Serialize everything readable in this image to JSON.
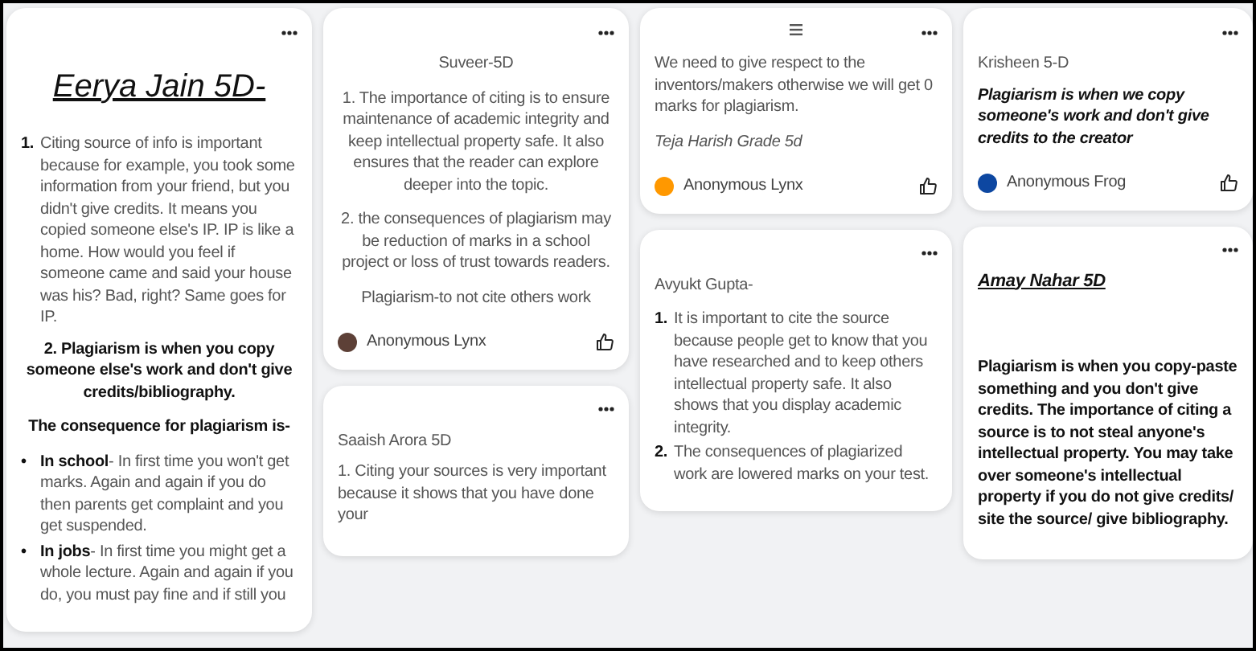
{
  "columns": [
    {
      "cards": [
        {
          "kind": "plain",
          "blocks": [
            {
              "kind": "title",
              "text": "Eerya Jain 5D-"
            },
            {
              "kind": "numbered",
              "items": [
                {
                  "marker": "1.",
                  "text": "Citing source of info is important because for example, you took some information from your friend, but you didn't give credits. It means you copied someone else's IP. IP is like a home. How would you feel if someone came and said your house was his? Bad, right? Same goes for IP."
                }
              ]
            },
            {
              "kind": "bold-center",
              "text": "2. Plagiarism is when you copy someone else's work and don't give credits/bibliography."
            },
            {
              "kind": "bold-center",
              "text": "The consequence for plagiarism is-"
            },
            {
              "kind": "bullets",
              "items": [
                {
                  "marker": "•",
                  "text": "**In school**- In first time you won't get marks. Again and again if you do then parents get complaint and you get suspended."
                },
                {
                  "marker": "•",
                  "text": "**In jobs**- In first time you might get a whole lecture. Again and again if you do, you must pay fine and if still you"
                }
              ]
            }
          ]
        }
      ]
    },
    {
      "cards": [
        {
          "kind": "plain",
          "blocks": [
            {
              "kind": "center",
              "text": "Suveer-5D"
            },
            {
              "kind": "center",
              "text": "1. The importance of citing is to ensure maintenance of academic integrity and keep intellectual property safe. It also ensures that the reader can explore deeper into the topic."
            },
            {
              "kind": "center",
              "text": "2. the consequences of plagiarism may be reduction of marks in a school project or loss of trust towards readers."
            },
            {
              "kind": "center",
              "text": "Plagiarism-to not cite others work"
            }
          ],
          "author": {
            "name": "Anonymous Lynx",
            "color": "#5d4037"
          }
        },
        {
          "kind": "plain",
          "blocks": [
            {
              "kind": "label",
              "text": "Saaish Arora 5D"
            },
            {
              "kind": "left",
              "text": "1. Citing your sources is very important because it shows that you have done your"
            }
          ]
        }
      ]
    },
    {
      "cards": [
        {
          "kind": "handle",
          "blocks": [
            {
              "kind": "left",
              "text": "We need to give respect to the inventors/makers otherwise we will get 0 marks for plagiarism."
            },
            {
              "kind": "italic",
              "text": "Teja Harish Grade 5d"
            }
          ],
          "author": {
            "name": "Anonymous Lynx",
            "color": "#ff9800"
          }
        },
        {
          "kind": "plain",
          "blocks": [
            {
              "kind": "left",
              "text": "Avyukt Gupta-"
            },
            {
              "kind": "numbered",
              "items": [
                {
                  "marker": "1.",
                  "text": "It is important to cite the source because people get to know that you have  researched and to keep others intellectual property safe. It also shows that you display academic integrity."
                },
                {
                  "marker": "2.",
                  "text": "The consequences of plagiarized work are lowered marks on your test."
                }
              ]
            }
          ]
        }
      ]
    },
    {
      "cards": [
        {
          "kind": "plain",
          "blocks": [
            {
              "kind": "label",
              "text": "Krisheen 5-D"
            },
            {
              "kind": "bold-italic",
              "text": "Plagiarism is when we copy someone's work and don't give credits to the creator"
            }
          ],
          "author": {
            "name": "Anonymous Frog",
            "color": "#0d47a1"
          }
        },
        {
          "kind": "plain",
          "blocks": [
            {
              "kind": "subtitle",
              "text": "Amay Nahar 5D"
            },
            {
              "kind": "bold",
              "text": "Plagiarism is when you copy-paste something and you don't give credits. The importance of citing a source is to not steal anyone's intellectual property. You may take over someone's intellectual property if you do not give credits/ site the source/ give bibliography."
            }
          ]
        }
      ]
    }
  ]
}
